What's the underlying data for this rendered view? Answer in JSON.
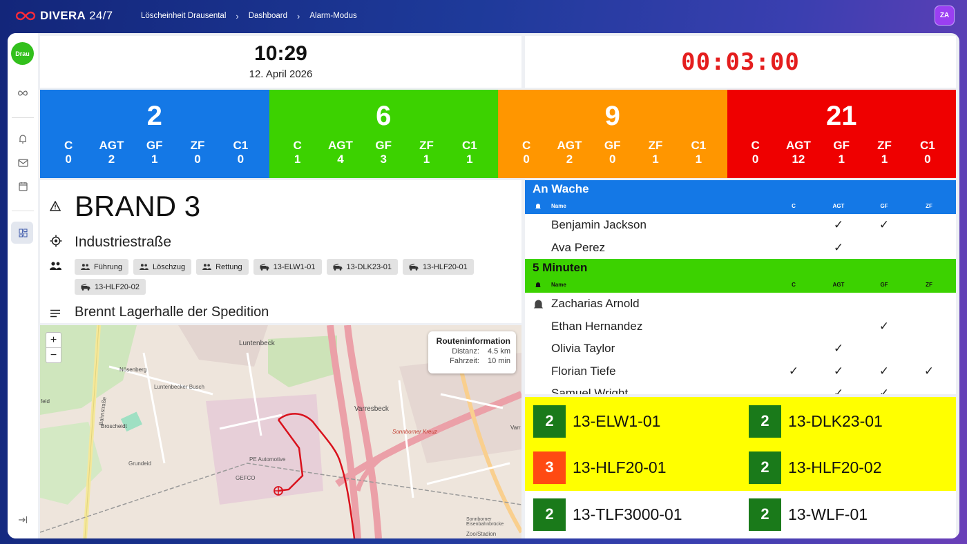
{
  "topbar": {
    "brand": "DIVERA",
    "brand_suffix": "24/7",
    "breadcrumbs": [
      "Löscheinheit Drausental",
      "Dashboard",
      "Alarm-Modus"
    ],
    "avatar": "ZA"
  },
  "sidebar": {
    "org_label": "Drau",
    "items": [
      "infinity-icon",
      "alarm-bell-icon",
      "mail-icon",
      "calendar-icon",
      "dashboard-icon",
      "logout-icon"
    ]
  },
  "clock": {
    "time": "10:29",
    "date": "12. April 2026"
  },
  "timer": "00:03:00",
  "status_groups": [
    {
      "total": "2",
      "color": "#1478e6",
      "labels": [
        "C",
        "AGT",
        "GF",
        "ZF",
        "C1"
      ],
      "values": [
        "0",
        "2",
        "1",
        "0",
        "0"
      ]
    },
    {
      "total": "6",
      "color": "#3cd200",
      "labels": [
        "C",
        "AGT",
        "GF",
        "ZF",
        "C1"
      ],
      "values": [
        "1",
        "4",
        "3",
        "1",
        "1"
      ]
    },
    {
      "total": "9",
      "color": "#ff9600",
      "labels": [
        "C",
        "AGT",
        "GF",
        "ZF",
        "C1"
      ],
      "values": [
        "0",
        "2",
        "0",
        "1",
        "1"
      ]
    },
    {
      "total": "21",
      "color": "#ef0000",
      "labels": [
        "C",
        "AGT",
        "GF",
        "ZF",
        "C1"
      ],
      "values": [
        "0",
        "12",
        "1",
        "1",
        "0"
      ]
    }
  ],
  "alarm": {
    "keyword": "BRAND 3",
    "address": "Industriestraße",
    "chips": [
      {
        "label": "Führung",
        "kind": "group"
      },
      {
        "label": "Löschzug",
        "kind": "group"
      },
      {
        "label": "Rettung",
        "kind": "group"
      },
      {
        "label": "13-ELW1-01",
        "kind": "vehicle"
      },
      {
        "label": "13-DLK23-01",
        "kind": "vehicle"
      },
      {
        "label": "13-HLF20-01",
        "kind": "vehicle"
      },
      {
        "label": "13-HLF20-02",
        "kind": "vehicle"
      }
    ],
    "description": "Brennt Lagerhalle der Spedition"
  },
  "map": {
    "zoom_in": "+",
    "zoom_out": "−",
    "route_title": "Routeninformation",
    "distance_label": "Distanz:",
    "distance": "4.5 km",
    "duration_label": "Fahrzeit:",
    "duration": "10 min",
    "labels": [
      "Luntenbeck",
      "Nösenberg",
      "Luntenbecker Busch",
      "Varresbeck",
      "Sonnborner Kreuz",
      "Broscheidt",
      "Grundeid",
      "PE Automotive",
      "GEFCO",
      "Sonnborner Eisenbahnbrücke",
      "Zoo/Stadion",
      "Bahnstraße",
      "feld",
      "Varr"
    ]
  },
  "staff": {
    "columns": {
      "name": "Name",
      "c": "C",
      "agt": "AGT",
      "gf": "GF",
      "zf": "ZF"
    },
    "groups": [
      {
        "title": "An Wache",
        "color": "#1478e6",
        "text_color": "#ffffff",
        "rows": [
          {
            "name": "Benjamin Jackson",
            "bell": false,
            "c": "",
            "agt": "✓",
            "gf": "✓",
            "zf": ""
          },
          {
            "name": "Ava Perez",
            "bell": false,
            "c": "",
            "agt": "✓",
            "gf": "",
            "zf": ""
          }
        ]
      },
      {
        "title": "5 Minuten",
        "color": "#3cd200",
        "text_color": "#111111",
        "rows": [
          {
            "name": "Zacharias Arnold",
            "bell": true,
            "c": "",
            "agt": "",
            "gf": "",
            "zf": ""
          },
          {
            "name": "Ethan Hernandez",
            "bell": false,
            "c": "",
            "agt": "",
            "gf": "✓",
            "zf": ""
          },
          {
            "name": "Olivia Taylor",
            "bell": false,
            "c": "",
            "agt": "✓",
            "gf": "",
            "zf": ""
          },
          {
            "name": "Florian Tiefe",
            "bell": false,
            "c": "✓",
            "agt": "✓",
            "gf": "✓",
            "zf": "✓"
          },
          {
            "name": "Samuel Wright",
            "bell": false,
            "c": "",
            "agt": "✓",
            "gf": "✓",
            "zf": ""
          }
        ]
      }
    ]
  },
  "vehicles": [
    {
      "status": "2",
      "name": "13-ELW1-01",
      "color": "#1a7a1a"
    },
    {
      "status": "2",
      "name": "13-DLK23-01",
      "color": "#1a7a1a"
    },
    {
      "status": "3",
      "name": "13-HLF20-01",
      "color": "#ff4a12"
    },
    {
      "status": "2",
      "name": "13-HLF20-02",
      "color": "#1a7a1a"
    },
    {
      "status": "2",
      "name": "13-TLF3000-01",
      "color": "#1a7a1a"
    },
    {
      "status": "2",
      "name": "13-WLF-01",
      "color": "#1a7a1a"
    }
  ]
}
